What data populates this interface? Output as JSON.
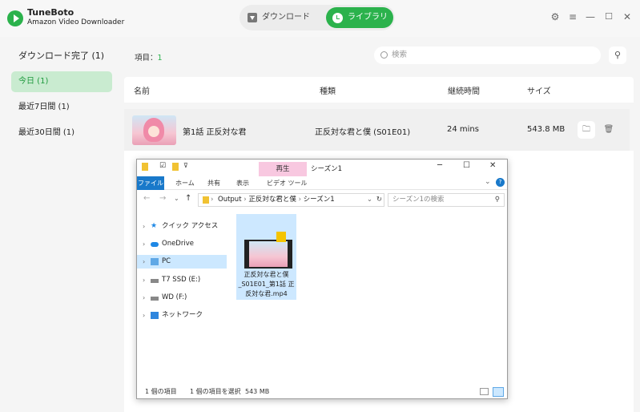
{
  "app": {
    "name": "TuneBoto",
    "subtitle": "Amazon Video Downloader"
  },
  "nav": {
    "download_label": "ダウンロード",
    "library_label": "ライブラリ"
  },
  "sidebar": {
    "items": [
      {
        "label": "ダウンロード完了 (1)"
      },
      {
        "label": "今日 (1)"
      },
      {
        "label": "最近7日間 (1)"
      },
      {
        "label": "最近30日間 (1)"
      }
    ]
  },
  "main": {
    "items_label": "項目：",
    "items_count": "1",
    "search_placeholder": "検索",
    "columns": [
      "名前",
      "種類",
      "継続時間",
      "サイズ"
    ],
    "rows": [
      {
        "name": "第1話 正反対な君",
        "type": "正反対な君と僕 (S01E01)",
        "duration": "24 mins",
        "size": "543.8 MB"
      }
    ]
  },
  "explorer": {
    "title": "シーズン1",
    "context_tab": "再生",
    "ribbon_tabs": [
      "ファイル",
      "ホーム",
      "共有",
      "表示",
      "ビデオ ツール"
    ],
    "breadcrumb": [
      "Output",
      "正反対な君と僕",
      "シーズン1"
    ],
    "search_placeholder": "シーズン1の検索",
    "nav_items": [
      {
        "label": "クイック アクセス"
      },
      {
        "label": "OneDrive"
      },
      {
        "label": "PC"
      },
      {
        "label": "T7 SSD (E:)"
      },
      {
        "label": "WD (F:)"
      },
      {
        "label": "ネットワーク"
      }
    ],
    "file": {
      "name": "正反対な君と僕_S01E01_第1話 正反対な君.mp4",
      "badge": "Player"
    },
    "status": {
      "count": "1 個の項目",
      "selected": "1 個の項目を選択",
      "size": "543 MB"
    }
  }
}
